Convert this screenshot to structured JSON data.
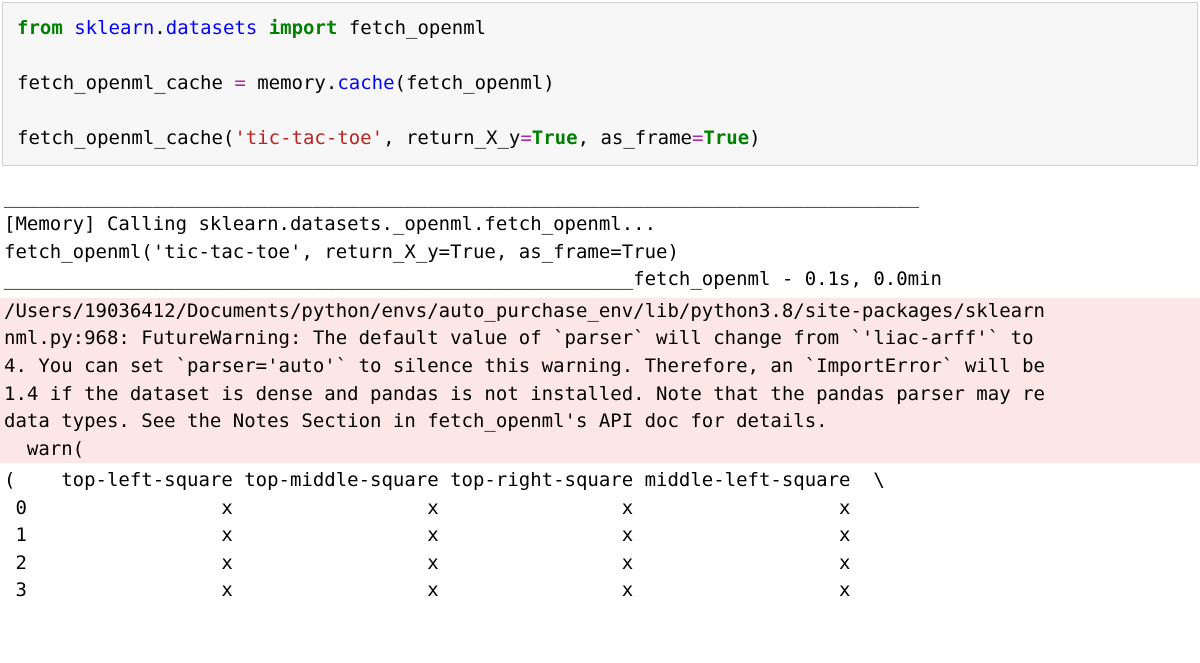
{
  "code": {
    "line1": {
      "from": "from",
      "mod1": "sklearn",
      "dot1": ".",
      "mod2": "datasets",
      "import": "import",
      "name": "fetch_openml"
    },
    "line2": {
      "lhs": "fetch_openml_cache ",
      "eq": "=",
      "mid": " memory",
      "dot": ".",
      "cache": "cache",
      "rest": "(fetch_openml)"
    },
    "line3": {
      "call": "fetch_openml_cache(",
      "str": "'tic-tac-toe'",
      "sep1": ", return_X_y",
      "eq1": "=",
      "true1": "True",
      "sep2": ", as_frame",
      "eq2": "=",
      "true2": "True",
      "close": ")"
    }
  },
  "output": {
    "rule1": "________________________________________________________________________________",
    "mem_line": "[Memory] Calling sklearn.datasets._openml.fetch_openml...",
    "call_line": "fetch_openml('tic-tac-toe', return_X_y=True, as_frame=True)",
    "rule2": "_______________________________________________________fetch_openml - 0.1s, 0.0min"
  },
  "warning": {
    "l1": "/Users/19036412/Documents/python/envs/auto_purchase_env/lib/python3.8/site-packages/sklearn",
    "l2": "nml.py:968: FutureWarning: The default value of `parser` will change from `'liac-arff'` to ",
    "l3": "4. You can set `parser='auto'` to silence this warning. Therefore, an `ImportError` will be",
    "l4": "1.4 if the dataset is dense and pandas is not installed. Note that the pandas parser may re",
    "l5": "data types. See the Notes Section in fetch_openml's API doc for details.",
    "l6": "  warn("
  },
  "result": {
    "header": "(    top-left-square top-middle-square top-right-square middle-left-square  \\",
    "r0": " 0                 x                 x                x                  x   ",
    "r1": " 1                 x                 x                x                  x   ",
    "r2": " 2                 x                 x                x                  x   ",
    "r3": " 3                 x                 x                x                  x   "
  }
}
